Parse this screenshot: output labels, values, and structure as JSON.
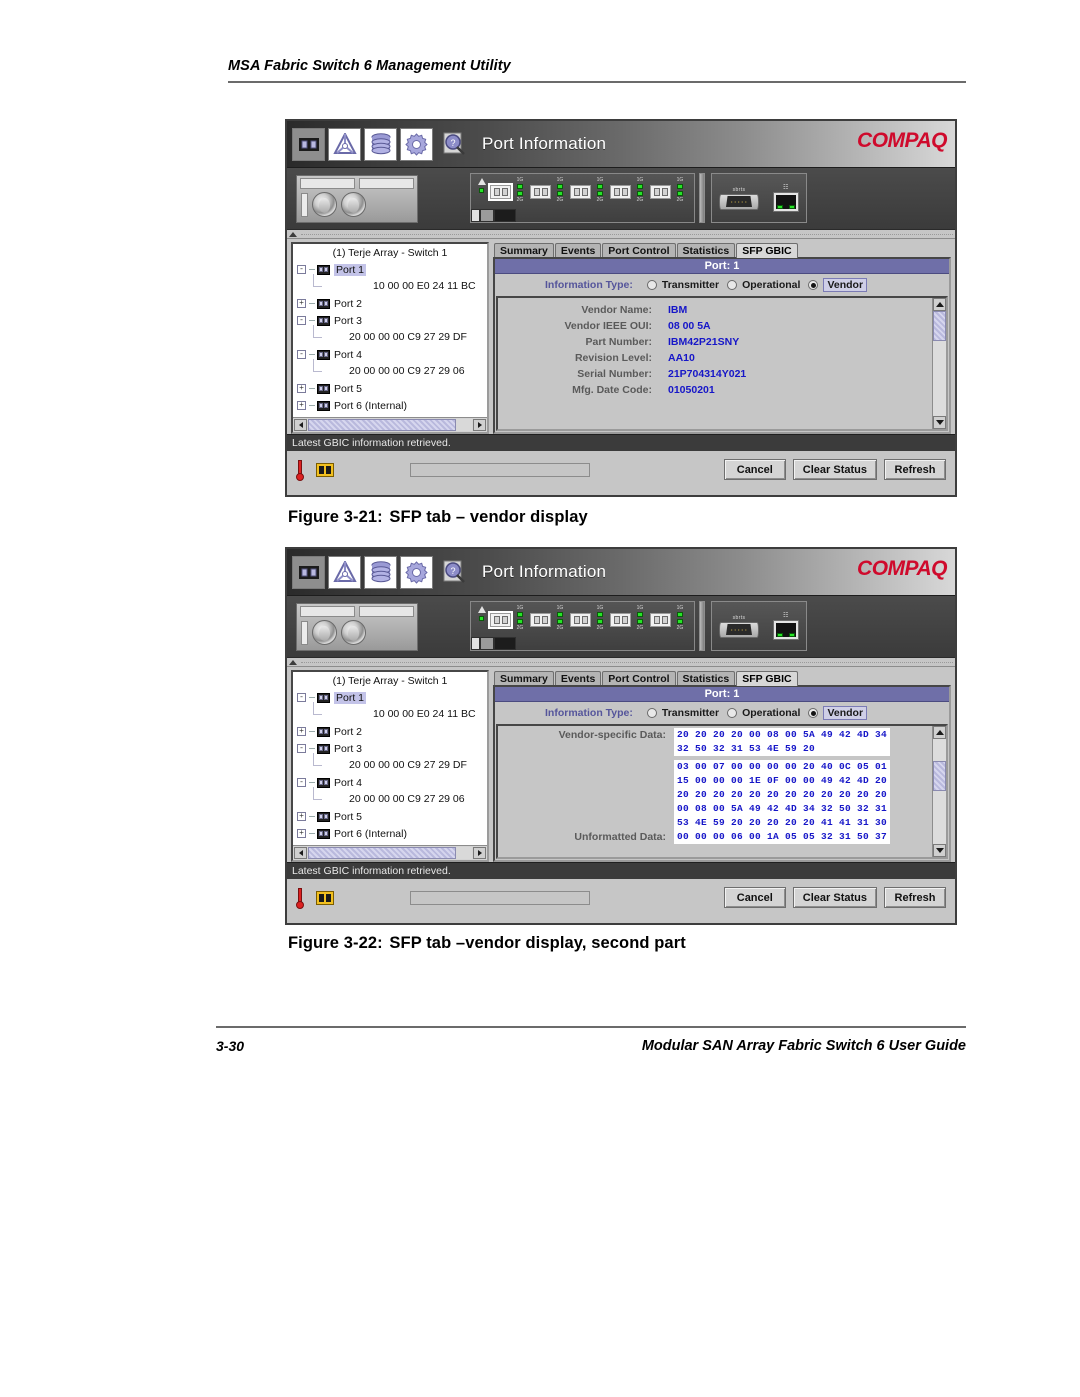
{
  "page": {
    "running_head": "MSA Fabric Switch 6 Management Utility",
    "footer_page_number": "3-30",
    "footer_title": "Modular SAN Array Fabric Switch 6 User Guide",
    "figure1_caption_number": "Figure 3-21:",
    "figure1_caption_text": "SFP tab – vendor display",
    "figure2_caption_number": "Figure 3-22:",
    "figure2_caption_text": "SFP tab –vendor display, second part"
  },
  "app": {
    "window_title": "Port Information",
    "brand": "COMPAQ",
    "brand_color": "#cf0a2c",
    "accent_color": "#6f6fa8",
    "value_color": "#1616c8",
    "toolbar_icons": [
      {
        "name": "ports-icon",
        "selected": true
      },
      {
        "name": "fabric-topology-icon",
        "selected": false
      },
      {
        "name": "database-icon",
        "selected": false
      },
      {
        "name": "gear-settings-icon",
        "selected": false
      },
      {
        "name": "magnifier-info-icon",
        "selected": false
      }
    ],
    "panel": {
      "sfp_port_count": 5,
      "speed_label_top": "1G",
      "speed_label_bottom": "2G",
      "serial_label": "sbrts",
      "highlighted_port_index": 0
    },
    "tree": {
      "root": "(1) Terje Array - Switch 1",
      "nodes": [
        {
          "toggle": "-",
          "label": "Port 1",
          "selected": true,
          "wwn": "10 00 00 E0 24 11 BC"
        },
        {
          "toggle": "+",
          "label": "Port 2",
          "selected": false,
          "wwn": null
        },
        {
          "toggle": "-",
          "label": "Port 3",
          "selected": false,
          "wwn": "20 00 00 00 C9 27 29 DF"
        },
        {
          "toggle": "-",
          "label": "Port 4",
          "selected": false,
          "wwn": "20 00 00 00 C9 27 29 06"
        },
        {
          "toggle": "+",
          "label": "Port 5",
          "selected": false,
          "wwn": null
        },
        {
          "toggle": "+",
          "label": "Port 6 (Internal)",
          "selected": false,
          "wwn": null
        }
      ]
    },
    "tabs": [
      {
        "label": "Summary",
        "active": false
      },
      {
        "label": "Events",
        "active": false
      },
      {
        "label": "Port Control",
        "active": false
      },
      {
        "label": "Statistics",
        "active": false
      },
      {
        "label": "SFP GBIC",
        "active": true
      }
    ],
    "port_header": "Port: 1",
    "information_type": {
      "label": "Information Type:",
      "options": [
        {
          "label": "Transmitter",
          "selected": false
        },
        {
          "label": "Operational",
          "selected": false
        },
        {
          "label": "Vendor",
          "selected": true
        }
      ]
    },
    "vendor_rows": [
      {
        "key": "Vendor Name:",
        "value": "IBM"
      },
      {
        "key": "Vendor IEEE OUI:",
        "value": "08 00 5A"
      },
      {
        "key": "Part Number:",
        "value": "IBM42P21SNY"
      },
      {
        "key": "Revision Level:",
        "value": "AA10"
      },
      {
        "key": "Serial Number:",
        "value": "21P704314Y021"
      },
      {
        "key": "Mfg. Date Code:",
        "value": "01050201"
      }
    ],
    "hex_sections": [
      {
        "key": "Vendor-specific Data:",
        "lines": [
          "20 20 20 20 00 08 00 5A 49 42 4D 34",
          "32 50 32 31 53 4E 59 20"
        ]
      },
      {
        "key": "Unformatted Data:",
        "lines": [
          "03 00 07 00 00 00 00 20 40 0C 05 01",
          "15 00 00 00 1E 0F 00 00 49 42 4D 20",
          "20 20 20 20 20 20 20 20 20 20 20 20",
          "00 08 00 5A 49 42 4D 34 32 50 32 31",
          "53 4E 59 20 20 20 20 20 41 41 31 30",
          "00 00 00 06 00 1A 05 05 32 31 50 37"
        ]
      }
    ],
    "status_text": "Latest GBIC information retrieved.",
    "buttons": [
      {
        "label": "Cancel",
        "name": "cancel-button"
      },
      {
        "label": "Clear Status",
        "name": "clear-status-button"
      },
      {
        "label": "Refresh",
        "name": "refresh-button"
      }
    ]
  }
}
